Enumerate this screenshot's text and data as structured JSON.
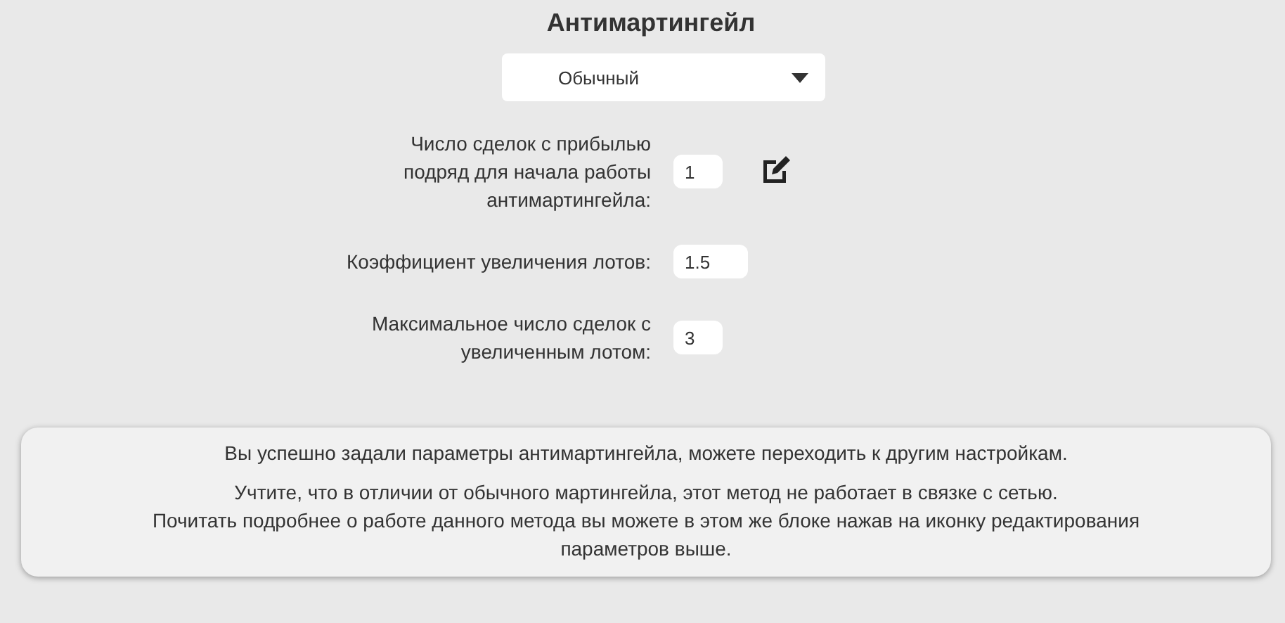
{
  "title": "Антимартингейл",
  "mode_select": {
    "value": "Обычный"
  },
  "params": [
    {
      "label": "Число сделок с прибылью подряд для начала работы антимартингейла:",
      "value": "1",
      "editable": true
    },
    {
      "label": "Коэффициент увеличения лотов:",
      "value": "1.5",
      "editable": false
    },
    {
      "label": "Максимальное число сделок с увеличенным лотом:",
      "value": "3",
      "editable": false
    }
  ],
  "notice": {
    "paragraphs": [
      "Вы успешно задали параметры антимартингейла, можете переходить к другим настройкам.",
      "Учтите, что в отличии от обычного мартингейла, этот метод не работает в связке с сетью.",
      "Почитать подробнее о работе данного метода вы можете в этом же блоке нажав на иконку редактирования параметров выше."
    ]
  }
}
